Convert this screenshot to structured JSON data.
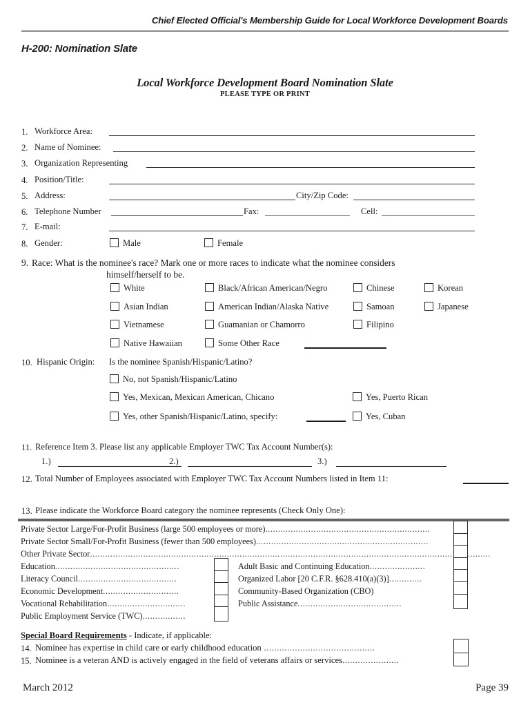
{
  "header": {
    "running_head": "Chief Elected Official's Membership Guide for Local Workforce Development Boards",
    "form_code": "H-200: Nomination Slate",
    "doc_title": "Local Workforce Development Board Nomination Slate",
    "doc_subtitle": "PLEASE TYPE OR PRINT"
  },
  "fields": {
    "n1": "1.",
    "f1": "Workforce Area:",
    "n2": "2.",
    "f2": "Name of Nominee:",
    "n3": "3.",
    "f3": "Organization Representing",
    "n4": "4.",
    "f4": "Position/Title:",
    "n5": "5.",
    "f5": "Address:",
    "f5b": "City/Zip Code:",
    "n6": "6.",
    "f6": "Telephone Number",
    "f6b": "Fax:",
    "f6c": "Cell:",
    "n7": "7.",
    "f7": "E-mail:",
    "n8": "8.",
    "f8": "Gender:",
    "gender_male": "Male",
    "gender_female": "Female"
  },
  "race": {
    "number": "9.",
    "question": "Race: What is the nominee's race? Mark one or more races to indicate what the nominee considers",
    "question_line2": "himself/herself to be.",
    "col1": [
      "White",
      "Asian Indian",
      "Vietnamese",
      "Native Hawaiian"
    ],
    "col2": [
      "Black/African American/Negro",
      "American Indian/Alaska Native",
      "Guamanian or Chamorro",
      "Some Other Race"
    ],
    "col3": [
      "Chinese",
      "Samoan",
      "Filipino"
    ],
    "col4": [
      "Korean",
      "Japanese"
    ]
  },
  "hispanic": {
    "number": "10.",
    "label": "Hispanic Origin:",
    "question": "Is the nominee Spanish/Hispanic/Latino?",
    "opt1": "No, not Spanish/Hispanic/Latino",
    "opt2": "Yes, Mexican, Mexican American, Chicano",
    "opt3": "Yes, other Spanish/Hispanic/Latino, specify:",
    "opt4": "Yes, Puerto Rican",
    "opt5": "Yes, Cuban"
  },
  "item11": {
    "number": "11.",
    "text_a": "Reference Item 3.  Please list any applicable ",
    "text_b": "Employer TWC Tax Account Number(s)",
    "text_c": ":",
    "sub1": "1.)",
    "sub2": "2.)",
    "sub3": "3.)"
  },
  "item12": {
    "number": "12.",
    "bold": "Total Number of Employees",
    "rest": " associated with Employer TWC Tax Account Numbers listed in Item 11:"
  },
  "item13": {
    "number": "13.",
    "text_a": "Please indicate the Workforce Board category the nominee represents ",
    "text_b": "(Check Only One):"
  },
  "categories": {
    "full_rows": [
      "Private Sector Large/For-Profit Business (large 500 employees or more)",
      "Private Sector Small/For-Profit Business (fewer than 500 employees)",
      "Other Private Sector"
    ],
    "left_rows": [
      "Education",
      "Literacy Council",
      "Economic Development",
      "Vocational Rehabilitation",
      "Public Employment Service (TWC)"
    ],
    "right_rows": [
      "Adult Basic and Continuing Education",
      "Organized Labor [20 C.F.R. §628.410(a)(3)]",
      "Community-Based Organization (CBO)",
      "Public Assistance"
    ]
  },
  "special": {
    "heading_bold": "Special Board Requirements",
    "heading_rest": " - Indicate, if applicable:",
    "n14": "14.",
    "i14_a": "Nominee has ",
    "i14_b": "expertise in child care or early childhood education",
    "n15": "15.",
    "i15_a": "Nominee is a ",
    "i15_b": "veteran AND is actively engaged",
    "i15_c": " in the field of veterans affairs or services"
  },
  "footer": {
    "date": "March 2012",
    "page": "Page 39"
  }
}
